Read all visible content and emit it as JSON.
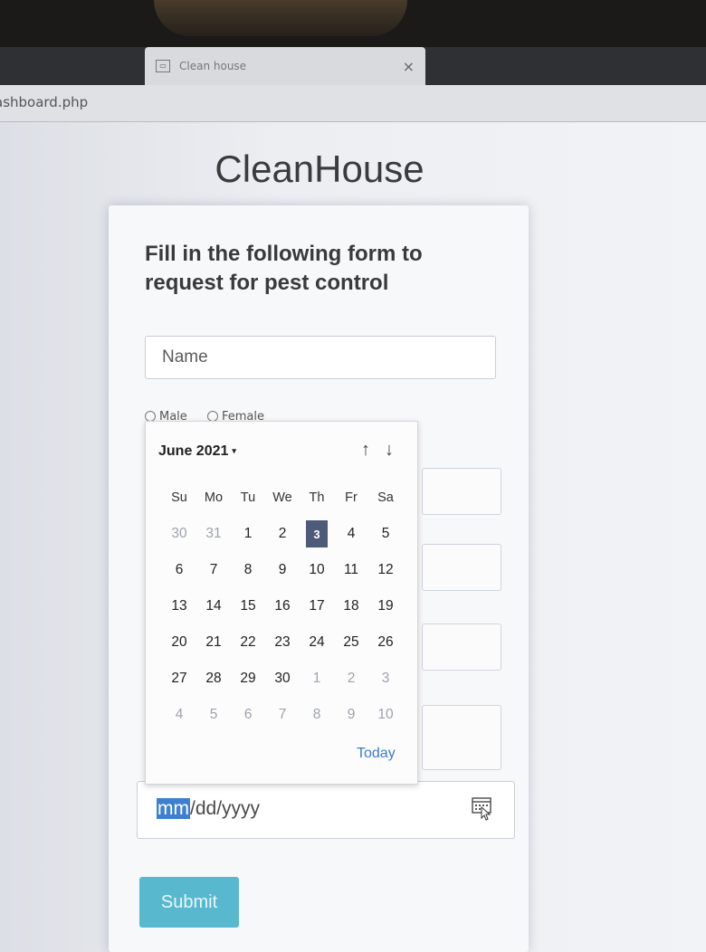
{
  "browser": {
    "tab_favicon": "page-icon",
    "tab_title": "Clean house",
    "tab_close": "×",
    "address": "ashboard.php"
  },
  "page": {
    "brand": "CleanHouse",
    "heading": "Fill in the following form to request for pest control",
    "name_placeholder": "Name",
    "gender_options": [
      "Male",
      "Female"
    ],
    "date_placeholder": {
      "selected_segment": "mm",
      "rest": "/dd/yyyy"
    },
    "submit_label": "Submit"
  },
  "datepicker": {
    "month_label": "June 2021",
    "caret": "▾",
    "up_arrow": "↑",
    "down_arrow": "↓",
    "weekdays": [
      "Su",
      "Mo",
      "Tu",
      "We",
      "Th",
      "Fr",
      "Sa"
    ],
    "days": [
      {
        "d": "30",
        "m": "other"
      },
      {
        "d": "31",
        "m": "other"
      },
      {
        "d": "1",
        "m": "cur"
      },
      {
        "d": "2",
        "m": "cur"
      },
      {
        "d": "3",
        "m": "selected"
      },
      {
        "d": "4",
        "m": "cur"
      },
      {
        "d": "5",
        "m": "cur"
      },
      {
        "d": "6",
        "m": "cur"
      },
      {
        "d": "7",
        "m": "cur"
      },
      {
        "d": "8",
        "m": "cur"
      },
      {
        "d": "9",
        "m": "cur"
      },
      {
        "d": "10",
        "m": "cur"
      },
      {
        "d": "11",
        "m": "cur"
      },
      {
        "d": "12",
        "m": "cur"
      },
      {
        "d": "13",
        "m": "cur"
      },
      {
        "d": "14",
        "m": "cur"
      },
      {
        "d": "15",
        "m": "cur"
      },
      {
        "d": "16",
        "m": "cur"
      },
      {
        "d": "17",
        "m": "cur"
      },
      {
        "d": "18",
        "m": "cur"
      },
      {
        "d": "19",
        "m": "cur"
      },
      {
        "d": "20",
        "m": "cur"
      },
      {
        "d": "21",
        "m": "cur"
      },
      {
        "d": "22",
        "m": "cur"
      },
      {
        "d": "23",
        "m": "cur"
      },
      {
        "d": "24",
        "m": "cur"
      },
      {
        "d": "25",
        "m": "cur"
      },
      {
        "d": "26",
        "m": "cur"
      },
      {
        "d": "27",
        "m": "cur"
      },
      {
        "d": "28",
        "m": "cur"
      },
      {
        "d": "29",
        "m": "cur"
      },
      {
        "d": "30",
        "m": "cur"
      },
      {
        "d": "1",
        "m": "other"
      },
      {
        "d": "2",
        "m": "other"
      },
      {
        "d": "3",
        "m": "other"
      },
      {
        "d": "4",
        "m": "other"
      },
      {
        "d": "5",
        "m": "other"
      },
      {
        "d": "6",
        "m": "other"
      },
      {
        "d": "7",
        "m": "other"
      },
      {
        "d": "8",
        "m": "other"
      },
      {
        "d": "9",
        "m": "other"
      },
      {
        "d": "10",
        "m": "other"
      }
    ],
    "today_label": "Today"
  },
  "colors": {
    "accent": "#58b8ce",
    "selected_day": "#4d5a78",
    "link": "#3b7bd0"
  }
}
